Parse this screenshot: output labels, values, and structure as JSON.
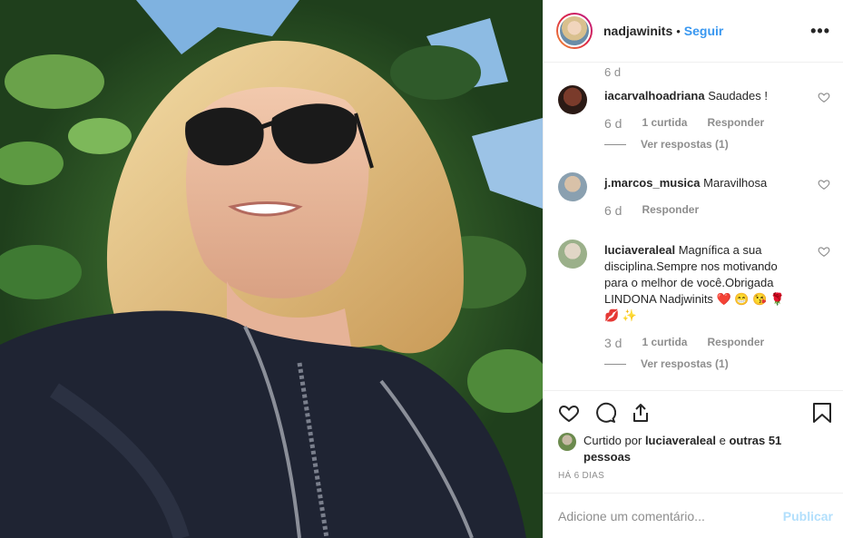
{
  "header": {
    "username": "nadjawinits",
    "separator": "•",
    "follow_label": "Seguir",
    "more_label": "•••"
  },
  "top_age": "6 d",
  "comments": [
    {
      "username": "iacarvalhoadriana",
      "text": "Saudades !",
      "age": "6 d",
      "likes": "1 curtida",
      "reply_label": "Responder",
      "view_replies": "Ver respostas (1)"
    },
    {
      "username": "j.marcos_musica",
      "text": "Maravilhosa",
      "age": "6 d",
      "reply_label": "Responder"
    },
    {
      "username": "luciaveraleal",
      "text": "Magnífica a sua disciplina.Sempre nos motivando para o melhor de você.Obrigada LINDONA Nadjwinits ❤️ 😁 😘 🌹 💋 ✨",
      "age": "3 d",
      "likes": "1 curtida",
      "reply_label": "Responder",
      "view_replies": "Ver respostas (1)"
    }
  ],
  "likes": {
    "prefix": "Curtido por",
    "user": "luciaveraleal",
    "suffix_1": "e",
    "others": "outras 51 pessoas"
  },
  "posted": "HÁ 6 DIAS",
  "add_comment": {
    "placeholder": "Adicione um comentário...",
    "publish_label": "Publicar"
  },
  "colors": {
    "link": "#3897f0",
    "muted": "#8e8e8e",
    "publish_disabled": "#b2dffc"
  }
}
